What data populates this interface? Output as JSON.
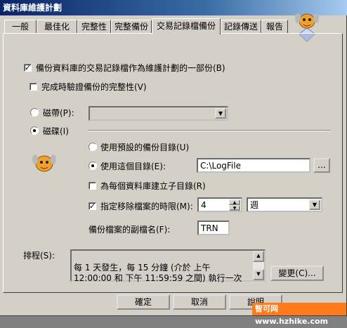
{
  "window": {
    "title": "資料庫維護計劃"
  },
  "tabs": [
    {
      "label": "一般"
    },
    {
      "label": "最佳化"
    },
    {
      "label": "完整性"
    },
    {
      "label": "完整備份"
    },
    {
      "label": "交易記錄檔備份"
    },
    {
      "label": "記錄傳送"
    },
    {
      "label": "報告"
    }
  ],
  "backup_log": {
    "label": "備份資料庫的交易記錄檔作為維護計劃的一部份(B)",
    "checked": true,
    "verify_label": "完成時驗證備份的完整性(V)",
    "verify_checked": false
  },
  "destination": {
    "tape_label": "磁帶(P):",
    "tape_selected": false,
    "tape_device": "",
    "disk_label": "磁碟(I)",
    "disk_selected": true
  },
  "directory": {
    "default_label": "使用預設的備份目錄(U)",
    "use_this_label": "使用這個目錄(E):",
    "path": "C:\\LogFile",
    "browse_label": "...",
    "subdir_label": "為每個資料庫建立子目錄(R)",
    "subdir_checked": false
  },
  "retention": {
    "label": "指定移除檔案的時限(M):",
    "checked": true,
    "value": "4",
    "unit": "週"
  },
  "extension": {
    "label": "備份檔案的副檔名(F):",
    "value": "TRN"
  },
  "schedule": {
    "label": "排程(S):",
    "text": "每 1 天發生，每 15 分鐘 (介於 上午 12:00:00 和 下午 11:59:59 之間) 執行一次",
    "change_label": "變更(C)..."
  },
  "footer": {
    "ok_label": "確定",
    "cancel_label": "取消",
    "help_label": "說明"
  },
  "watermark": {
    "text": "智可网 www.hzhike.com"
  },
  "colors": {
    "titlebar": "#0a246a",
    "face": "#d4d0c8",
    "watermark": "#ff7a1a"
  }
}
